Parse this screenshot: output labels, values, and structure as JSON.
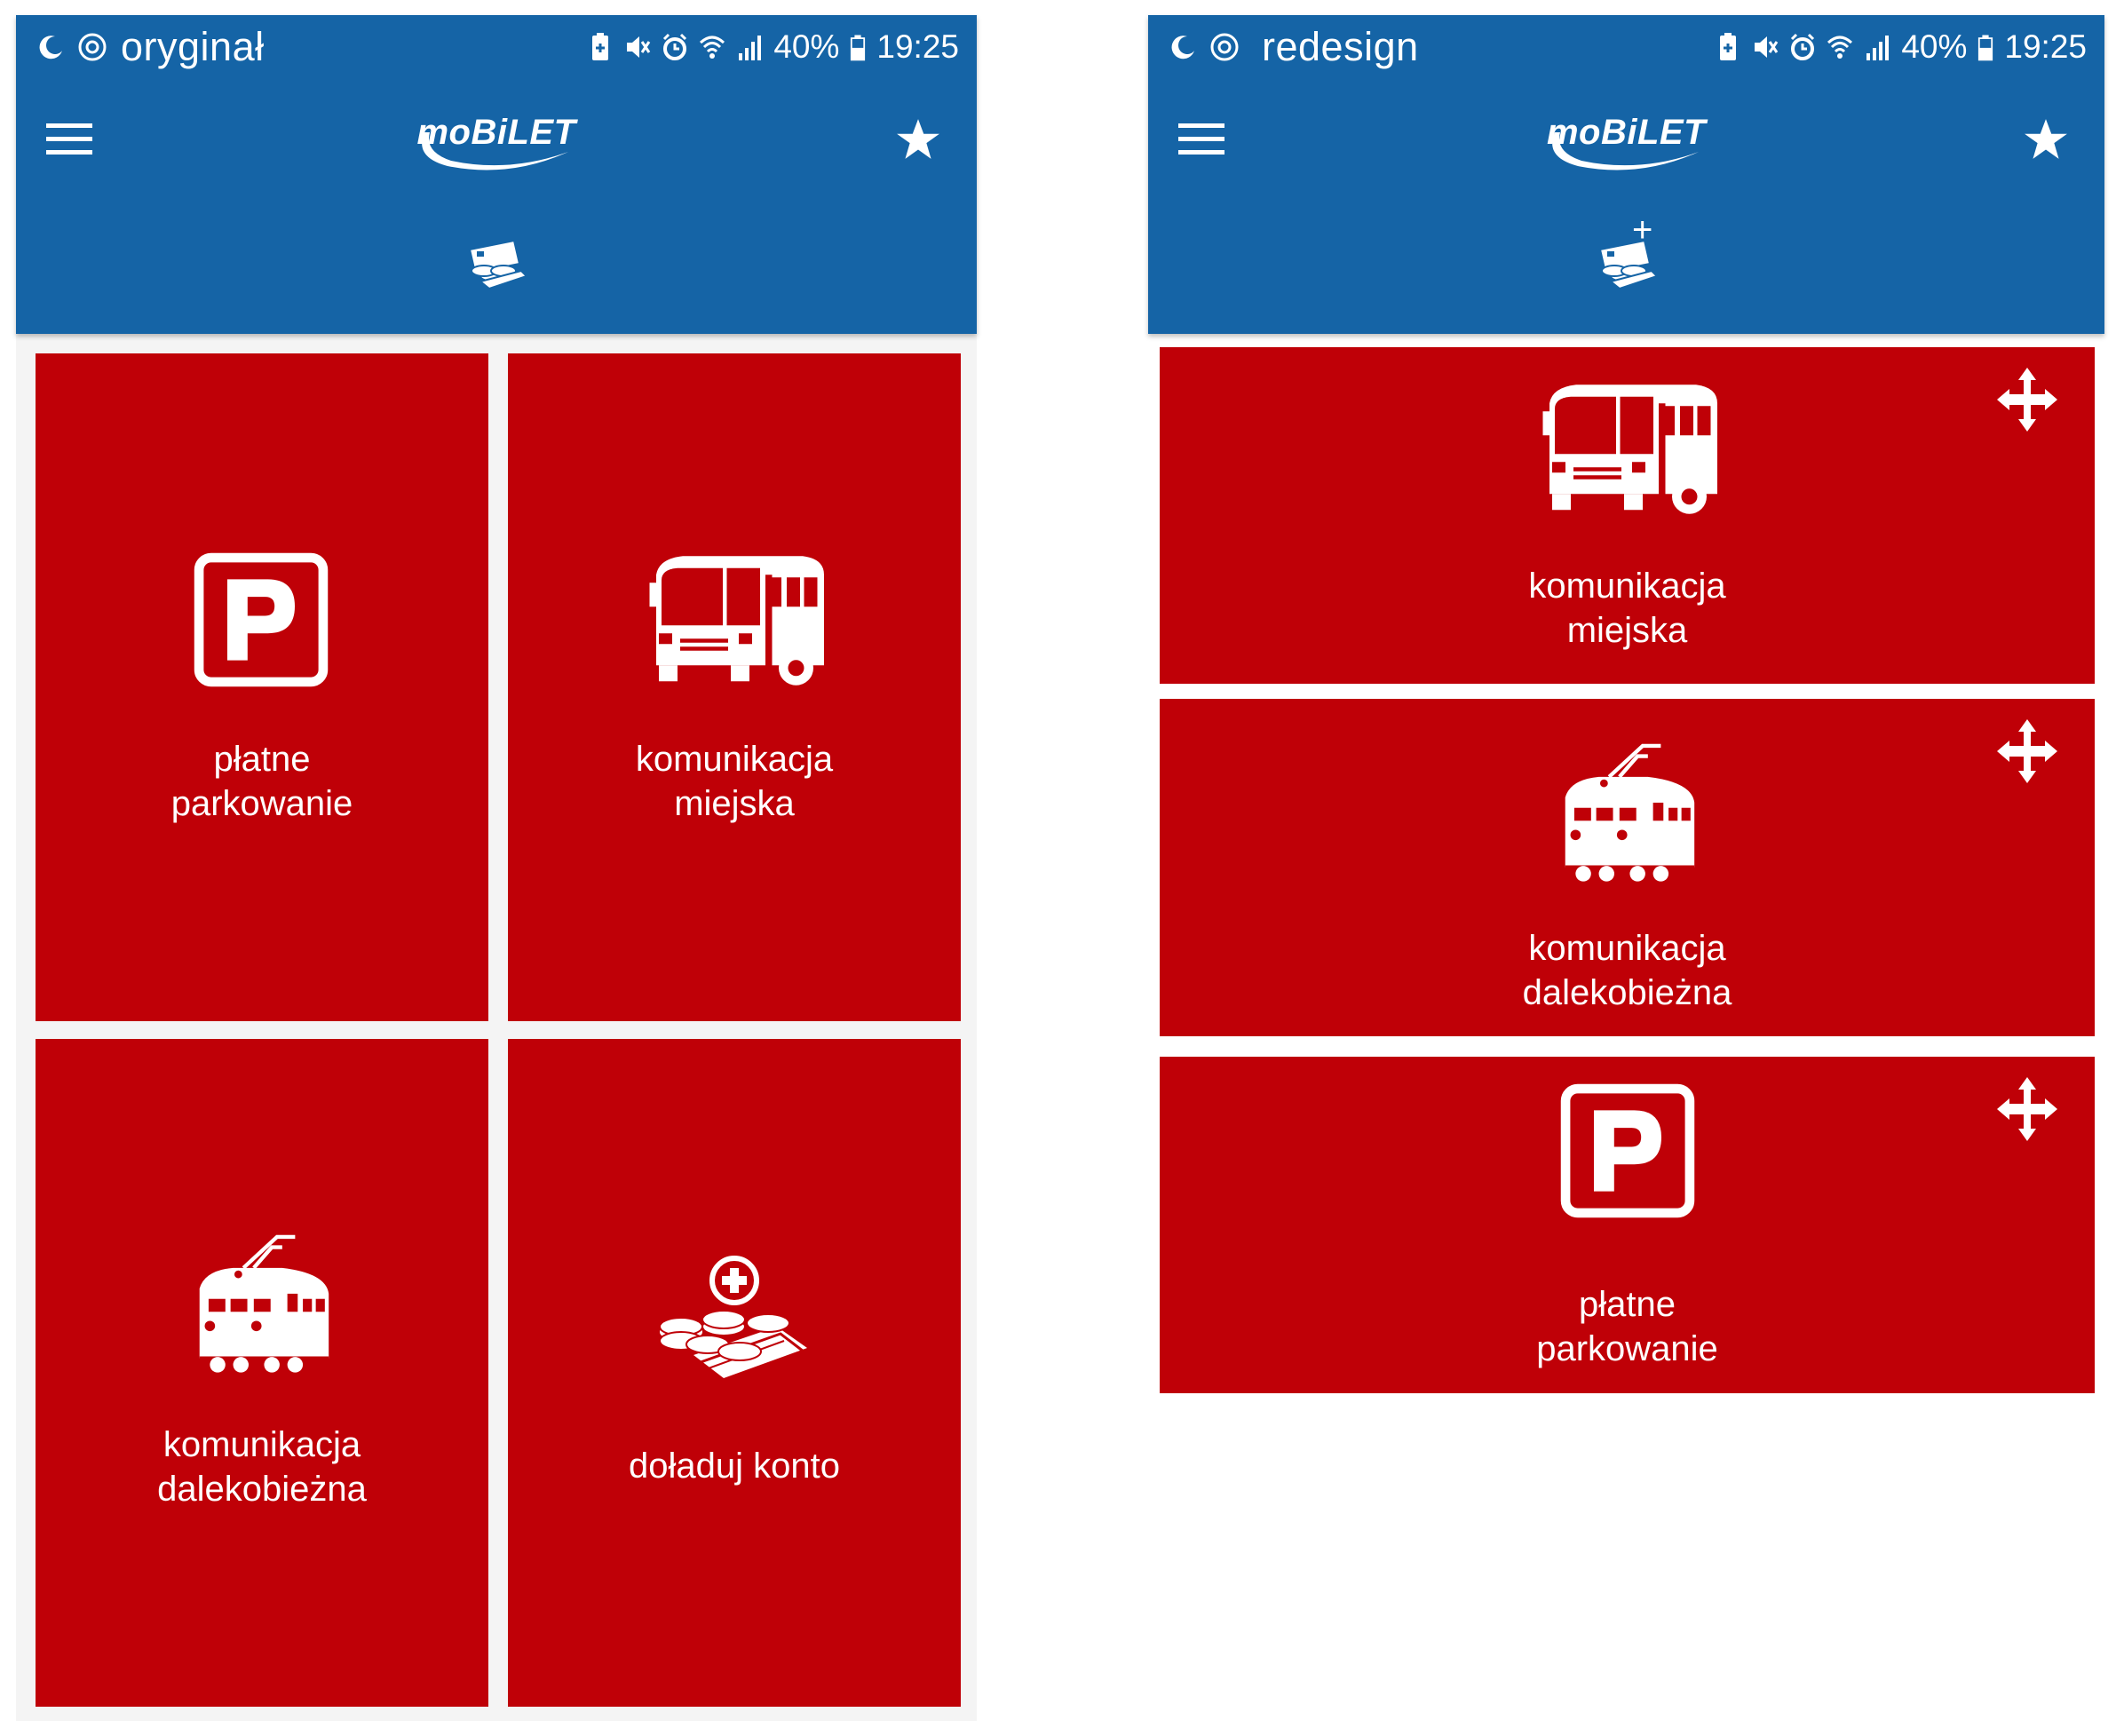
{
  "colors": {
    "appbar": "#1564a6",
    "tile": "#bf0007",
    "icon": "#ffffff"
  },
  "left": {
    "status": {
      "label": "oryginał",
      "battery": "40%",
      "time": "19:25"
    },
    "tiles": [
      {
        "icon": "parking-icon",
        "line1": "płatne",
        "line2": "parkowanie"
      },
      {
        "icon": "bus-icon",
        "line1": "komunikacja",
        "line2": "miejska"
      },
      {
        "icon": "train-icon",
        "line1": "komunikacja",
        "line2": "dalekobieżna"
      },
      {
        "icon": "top-up-icon",
        "line1": "doładuj konto"
      }
    ]
  },
  "right": {
    "status": {
      "label": "redesign",
      "battery": "40%",
      "time": "19:25"
    },
    "wallet_plus": "+",
    "tiles": [
      {
        "icon": "bus-icon",
        "line1": "komunikacja",
        "line2": "miejska",
        "handle": "move-icon"
      },
      {
        "icon": "train-icon",
        "line1": "komunikacja",
        "line2": "dalekobieżna",
        "handle": "move-icon"
      },
      {
        "icon": "parking-icon",
        "line1": "płatne",
        "line2": "parkowanie",
        "handle": "move-icon"
      }
    ]
  },
  "icons": {
    "menu": "menu-icon",
    "star": "star-icon",
    "wallet": "wallet-icon",
    "logo": "moBiLET"
  }
}
